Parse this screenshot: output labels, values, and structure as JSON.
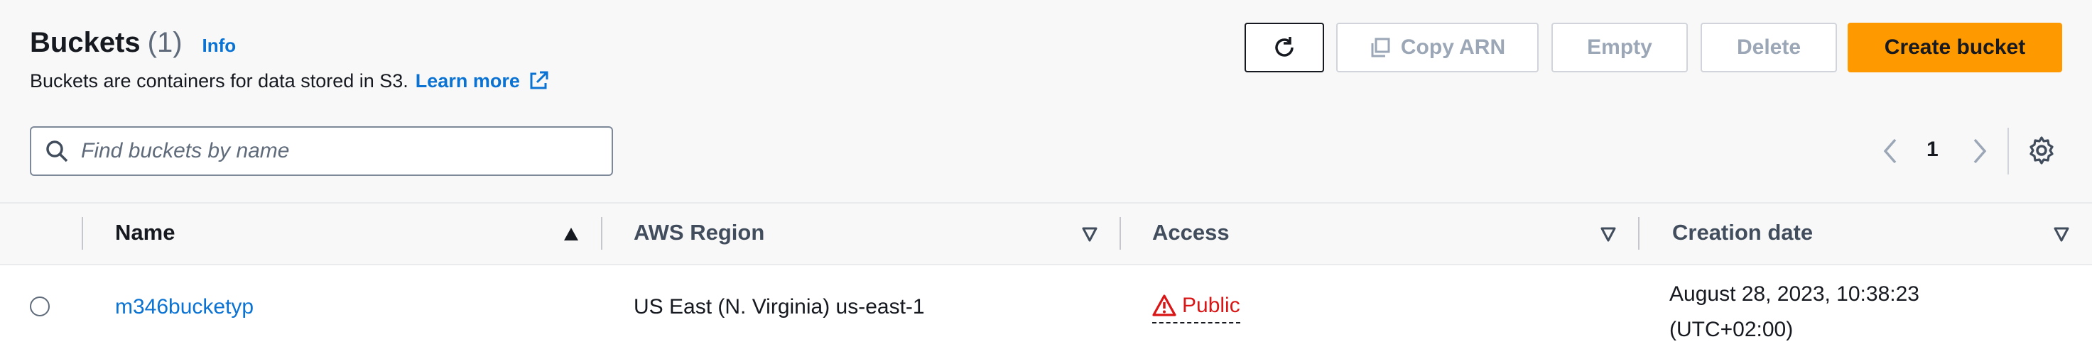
{
  "header": {
    "title": "Buckets",
    "count": "(1)",
    "info": "Info",
    "description": "Buckets are containers for data stored in S3.",
    "learn_more": "Learn more"
  },
  "toolbar": {
    "refresh_icon": "refresh-icon",
    "copy_arn": "Copy ARN",
    "empty": "Empty",
    "delete": "Delete",
    "create_bucket": "Create bucket"
  },
  "search": {
    "placeholder": "Find buckets by name",
    "value": ""
  },
  "pagination": {
    "current_page": "1"
  },
  "table": {
    "columns": [
      {
        "label": "Name",
        "sort": "ascending"
      },
      {
        "label": "AWS Region",
        "sort": "none"
      },
      {
        "label": "Access",
        "sort": "none"
      },
      {
        "label": "Creation date",
        "sort": "none"
      }
    ],
    "rows": [
      {
        "name": "m346bucketyp",
        "region": "US East (N. Virginia) us-east-1",
        "access": "Public",
        "creation_date_line1": "August 28, 2023, 10:38:23",
        "creation_date_line2": "(UTC+02:00)"
      }
    ]
  },
  "colors": {
    "primary": "#ff9900",
    "link": "#0972d3",
    "warning": "#d91515",
    "disabled": "#9ba7b6"
  }
}
